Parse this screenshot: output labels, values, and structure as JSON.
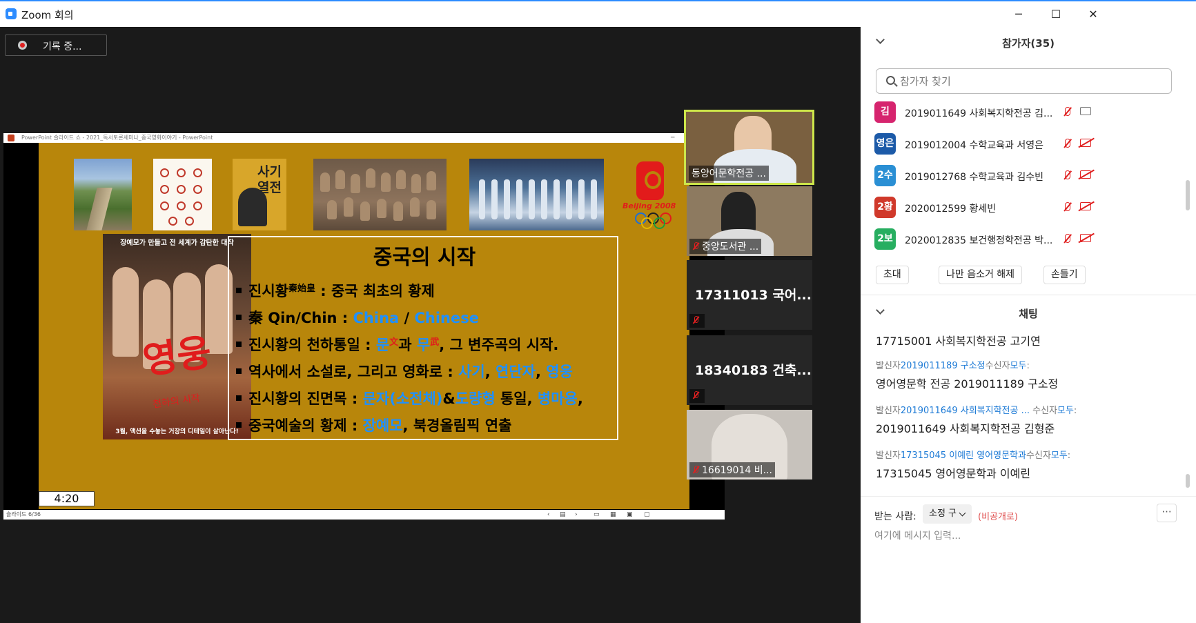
{
  "window": {
    "title": "Zoom 회의",
    "minimize": "─",
    "maximize": "☐",
    "close": "✕"
  },
  "recording": {
    "label": "기록 중..."
  },
  "share": {
    "ppt_title": "PowerPoint 슬라이드 쇼 - 2021_독서토론세미나_중국영화이야기 - PowerPoint",
    "status_left": "슬라이드 6/36",
    "timer": "4:20",
    "slide": {
      "book_title": "사기\n열전",
      "beijing_text": "Beijing 2008",
      "poster_top": "장예모가 만들고 전 세계가 감탄한 대작",
      "poster_title": "영웅",
      "poster_sub": "천하의 시작",
      "poster_bottom": "3월, 액션을 수놓는 거장의 디테일이 살아난다!",
      "heading": "중국의 시작",
      "line1": {
        "a": "진시황",
        "sup": "秦始皇",
        "b": " : 중국 최초의 황제"
      },
      "line2": {
        "a": "秦 Qin/Chin : ",
        "b": "China",
        "c": " / ",
        "d": "Chinese"
      },
      "line3": {
        "a": "진시황의 천하통일 : ",
        "b": "문",
        "bs": "文",
        "c": "과 ",
        "d": "무",
        "ds": "武",
        "e": ", 그 변주곡의 시작."
      },
      "line4": {
        "a": "역사에서 소설로, 그리고 영화로 : ",
        "b": "사기",
        "c": ", ",
        "d": "연단자",
        "e": ", ",
        "f": "영웅"
      },
      "line5": {
        "a": "진시황의 진면목 : ",
        "b": "문자(소전체)",
        "c": "&",
        "d": "도량형",
        "e": " 통일, ",
        "f": "병마용",
        "g": ","
      },
      "line6": {
        "a": "중국예술의 황제 : ",
        "b": "장예모",
        "c": ", 북경올림픽 연출"
      }
    }
  },
  "gallery": [
    {
      "name": "동양어문학전공 ...",
      "video": true,
      "active": true
    },
    {
      "name": "중앙도서관 ...",
      "video": true,
      "muted": true
    },
    {
      "name": "17311013 국어...",
      "video": false,
      "muted": true
    },
    {
      "name": "18340183 건축...",
      "video": false,
      "muted": true
    },
    {
      "name": "16619014 비...",
      "video": true,
      "muted": true
    }
  ],
  "participants": {
    "header": "참가자(35)",
    "search_placeholder": "참가자 찾기",
    "list": [
      {
        "avatar": "김",
        "name": "2019011649 사회복지학전공 김...",
        "color": "#d6246e",
        "cam_on": true
      },
      {
        "avatar": "영은",
        "name": "2019012004 수학교육과 서영은",
        "color": "#1c5aa8",
        "cam_on": false
      },
      {
        "avatar": "2수",
        "name": "2019012768 수학교육과 김수빈",
        "color": "#2a8fd4",
        "cam_on": false
      },
      {
        "avatar": "2황",
        "name": "2020012599 황세빈",
        "color": "#d0392b",
        "cam_on": false
      },
      {
        "avatar": "2보",
        "name": "2020012835 보건행정학전공 박...",
        "color": "#27ae60",
        "cam_on": false
      }
    ],
    "buttons": {
      "invite": "초대",
      "unmute_me": "나만 음소거 해제",
      "raise_hand": "손들기"
    }
  },
  "chat": {
    "header": "채팅",
    "messages": [
      {
        "meta_prefix": "",
        "sender": "",
        "mid": "",
        "target": "",
        "suffix": "",
        "text": "17715001 사회복지학전공 고기연"
      },
      {
        "meta_prefix": "발신자",
        "sender": "2019011189 구소정",
        "mid": "수신자",
        "target": "모두",
        "suffix": ":",
        "text": "영어영문학 전공 2019011189 구소정"
      },
      {
        "meta_prefix": "발신자",
        "sender": "2019011649 사회복지학전공 ...",
        "mid": "  수신자",
        "target": "모두",
        "suffix": ":",
        "text": "2019011649 사회복지학전공 김형준"
      },
      {
        "meta_prefix": "발신자",
        "sender": "17315045 이예린 영어영문학과",
        "mid": "수신자",
        "target": "모두",
        "suffix": ":",
        "text": "17315045 영어영문학과 이예린"
      }
    ],
    "to_label": "받는 사람:",
    "to_value": "소정 구",
    "private_label": "(비공개로)",
    "more": "···",
    "input_placeholder": "여기에 메시지 입력..."
  }
}
